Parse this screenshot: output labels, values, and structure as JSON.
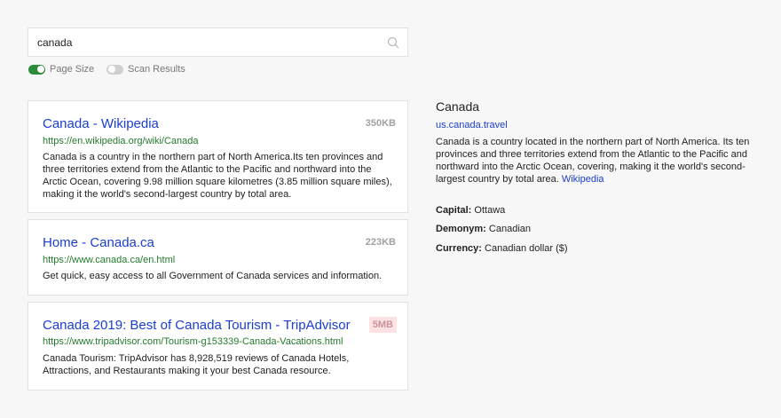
{
  "search": {
    "query": "canada"
  },
  "toggles": [
    {
      "label": "Page Size",
      "on": true
    },
    {
      "label": "Scan Results",
      "on": false
    }
  ],
  "results": [
    {
      "title": "Canada - Wikipedia",
      "url": "https://en.wikipedia.org/wiki/Canada",
      "size": "350KB",
      "desc": "Canada is a country in the northern part of North America.Its ten provinces and three territories extend from the Atlantic to the Pacific and northward into the Arctic Ocean, covering 9.98 million square kilometres (3.85 million square miles), making it the world's second-largest country by total area."
    },
    {
      "title": "Home - Canada.ca",
      "url": "https://www.canada.ca/en.html",
      "size": "223KB",
      "desc": "Get quick, easy access to all Government of Canada services and information."
    },
    {
      "title": "Canada 2019: Best of Canada Tourism - TripAdvisor",
      "url": "https://www.tripadvisor.com/Tourism-g153339-Canada-Vacations.html",
      "size": "5MB",
      "desc": "Canada Tourism: TripAdvisor has 8,928,519 reviews of Canada Hotels, Attractions, and Restaurants making it your best Canada resource."
    }
  ],
  "knowledge": {
    "title": "Canada",
    "link": "us.canada.travel",
    "desc": "Canada is a country located in the northern part of North America. Its ten provinces and three territories extend from the Atlantic to the Pacific and northward into the Arctic Ocean, covering, making it the world's second-largest country by total area.",
    "source": "Wikipedia",
    "facts": [
      {
        "label": "Capital:",
        "value": "Ottawa"
      },
      {
        "label": "Demonym:",
        "value": "Canadian"
      },
      {
        "label": "Currency:",
        "value": "Canadian dollar ($)"
      }
    ]
  },
  "colors": {
    "link": "#1a3ed1",
    "url": "#237a2c",
    "toggle_on": "#2e8b3a",
    "warn_badge": "#fde2e4"
  }
}
